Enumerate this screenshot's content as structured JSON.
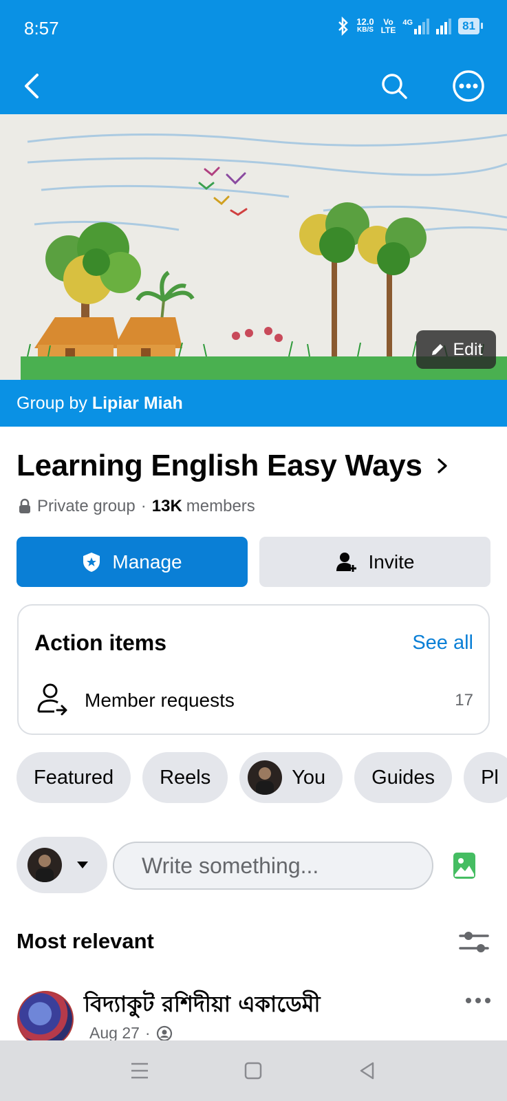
{
  "status_bar": {
    "time": "8:57",
    "net_speed_value": "12.0",
    "net_speed_unit": "KB/S",
    "volte_top": "Vo",
    "volte_bottom": "LTE",
    "network_type": "4G",
    "battery": "81"
  },
  "top_bar": {
    "back_icon": "chevron-left-icon",
    "search_icon": "search-icon",
    "more_icon": "more-circle-icon",
    "background_color": "#0a91e4"
  },
  "cover": {
    "edit_label": "Edit"
  },
  "group_by": {
    "prefix": "Group by",
    "owner": "Lipiar Miah"
  },
  "group": {
    "name": "Learning English Easy Ways",
    "privacy": "Private group",
    "separator": "·",
    "member_count": "13K",
    "members_label": "members"
  },
  "buttons": {
    "manage_label": "Manage",
    "invite_label": "Invite"
  },
  "action_items": {
    "title": "Action items",
    "see_all": "See all",
    "item_label": "Member requests",
    "item_count": "17"
  },
  "chips": [
    {
      "label": "Featured"
    },
    {
      "label": "Reels"
    },
    {
      "label": "You"
    },
    {
      "label": "Guides"
    },
    {
      "label": "Pl"
    }
  ],
  "composer": {
    "placeholder": "Write something..."
  },
  "feed": {
    "sort_title": "Most relevant",
    "post": {
      "author": "বিদ্যাকুট রশিদীয়া একাডেমী",
      "date": "Aug 27",
      "separator": "·"
    }
  },
  "colors": {
    "brand_blue": "#0a91e4",
    "button_blue": "#0a7fd6",
    "chip_gray": "#e4e6eb"
  }
}
